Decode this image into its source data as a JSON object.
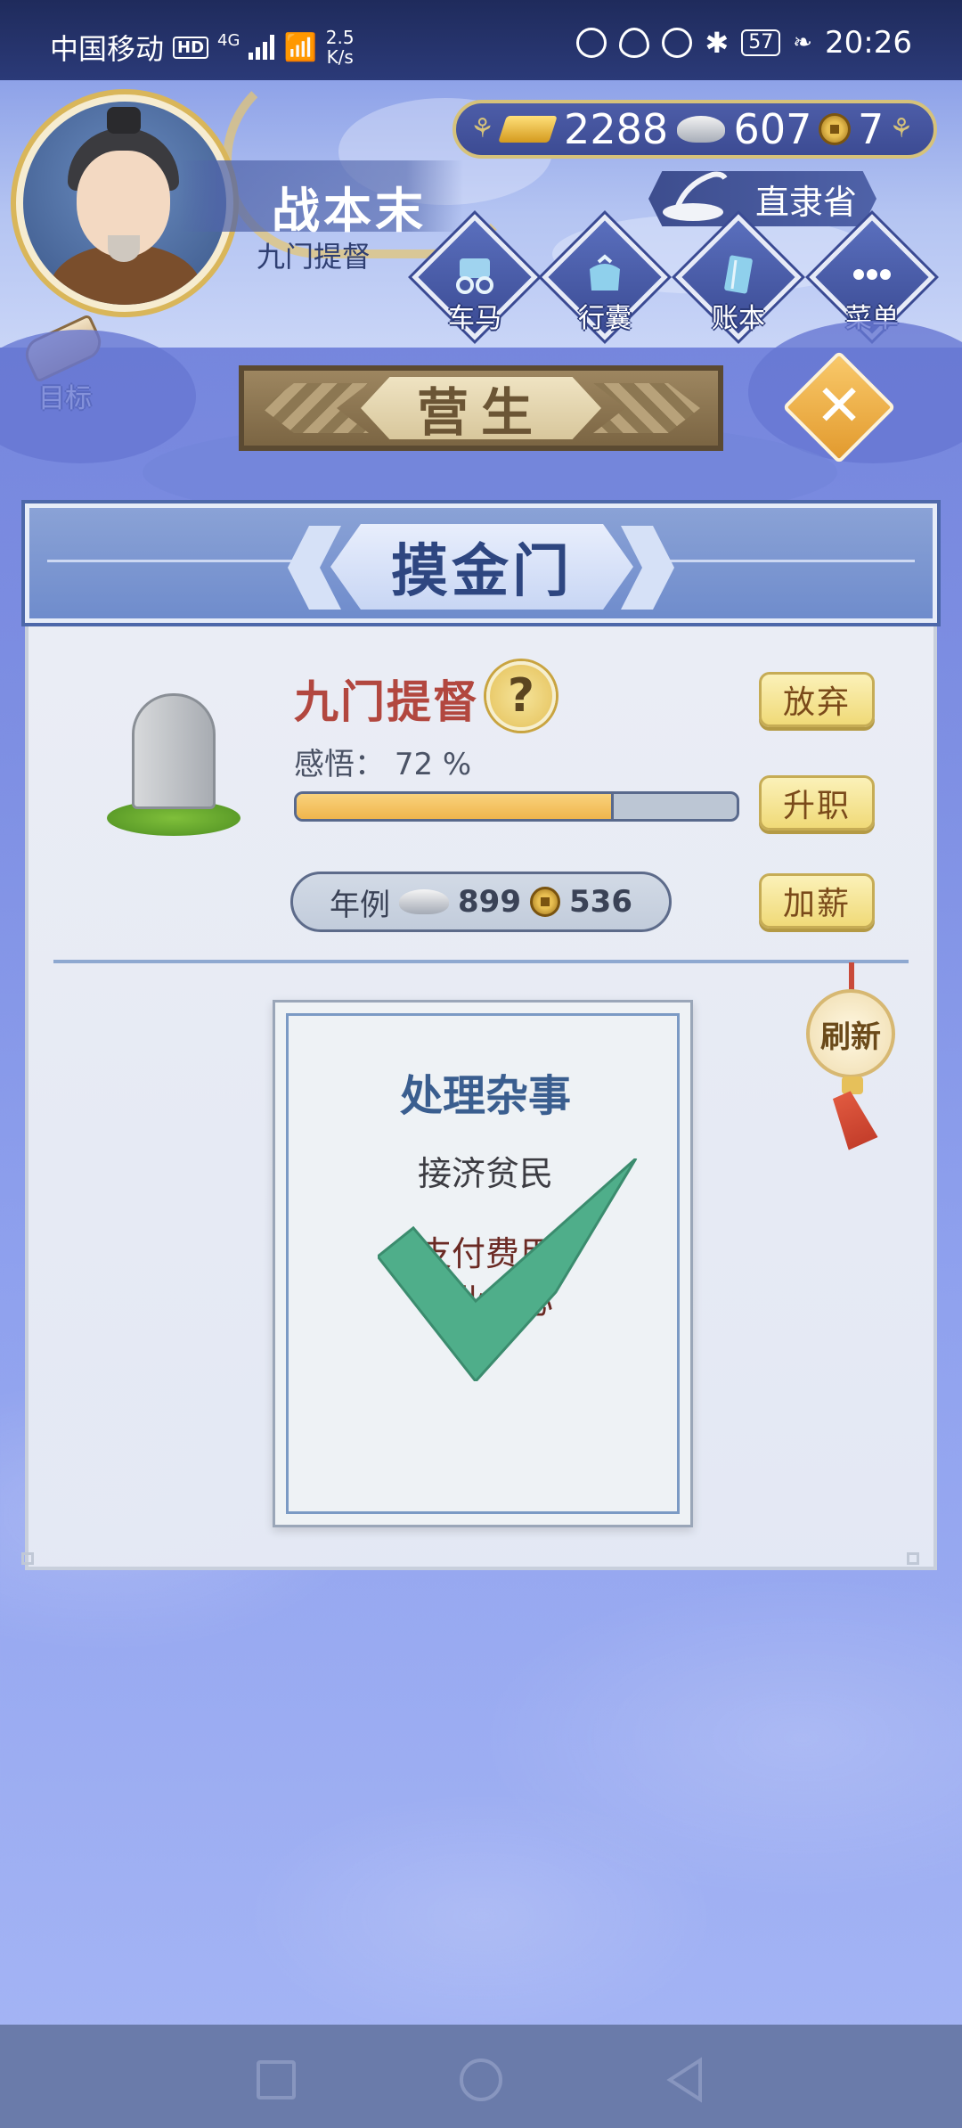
{
  "status_bar": {
    "carrier": "中国移动",
    "hd": "HD",
    "network": "4G",
    "speed_value": "2.5",
    "speed_unit": "K/s",
    "battery": "57",
    "time": "20:26",
    "icons": [
      "nfc-icon",
      "eye-icon",
      "alarm-icon",
      "bluetooth-icon",
      "battery-icon",
      "leaf-icon"
    ]
  },
  "player": {
    "name": "战本末",
    "title": "九门提督"
  },
  "currency": {
    "gold": "2288",
    "silver": "607",
    "coins": "7"
  },
  "region": {
    "label": "直隶省"
  },
  "nav": {
    "carriage": "车马",
    "bag": "行囊",
    "ledger": "账本",
    "menu": "菜单"
  },
  "goal": {
    "label": "目标"
  },
  "section_tab": {
    "label": "营生"
  },
  "panel": {
    "title": "摸金门",
    "job_name": "九门提督",
    "help_symbol": "?",
    "insight_label": "感悟：",
    "insight_value": "72 %",
    "insight_progress": 0.72,
    "salary_label": "年例",
    "salary_silver": "899",
    "salary_coins": "536",
    "buttons": {
      "give_up": "放弃",
      "promote": "升职",
      "raise": "加薪",
      "refresh": "刷新"
    }
  },
  "task_card": {
    "title": "处理杂事",
    "line1": "接济贫民",
    "line2": "支付费用",
    "line3": "职业关心",
    "completed": true
  },
  "colors": {
    "accent_gold": "#e7c770",
    "job_red": "#b2473f",
    "title_blue": "#2e4680",
    "check_green": "#4fae8a"
  }
}
